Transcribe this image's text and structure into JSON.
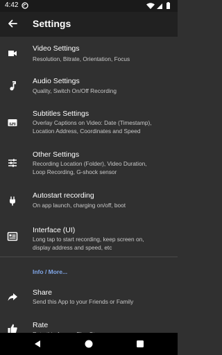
{
  "status_bar": {
    "time": "4:42"
  },
  "app_bar": {
    "title": "Settings"
  },
  "items": [
    {
      "title": "Video Settings",
      "subtitle": "Resolution, Bitrate, Orientation, Focus",
      "icon": "videocam-icon"
    },
    {
      "title": "Audio Settings",
      "subtitle": "Quality, Switch On/Off Recording",
      "icon": "music-note-icon"
    },
    {
      "title": "Subtitles Settings",
      "subtitle": "Overlay Captions on Video: Date (Timestamp),\nLocation Address, Coordinates and Speed",
      "icon": "subtitles-icon"
    },
    {
      "title": "Other Settings",
      "subtitle": "Recording Location (Folder), Video Duration,\nLoop Recording, G-shock sensor",
      "icon": "tune-icon"
    },
    {
      "title": "Autostart recording",
      "subtitle": "On app launch, charging on/off, boot",
      "icon": "power-plug-icon"
    },
    {
      "title": "Interface (UI)",
      "subtitle": "Long tap to start recording, keep screen on,\ndisplay address and speed, etc",
      "icon": "interface-icon"
    }
  ],
  "section_header": "Info / More...",
  "more_items": [
    {
      "title": "Share",
      "subtitle": "Send this App to your Friends or Family",
      "icon": "share-icon"
    },
    {
      "title": "Rate",
      "subtitle": "Rate this App on Play Store",
      "icon": "thumb-up-icon"
    }
  ]
}
